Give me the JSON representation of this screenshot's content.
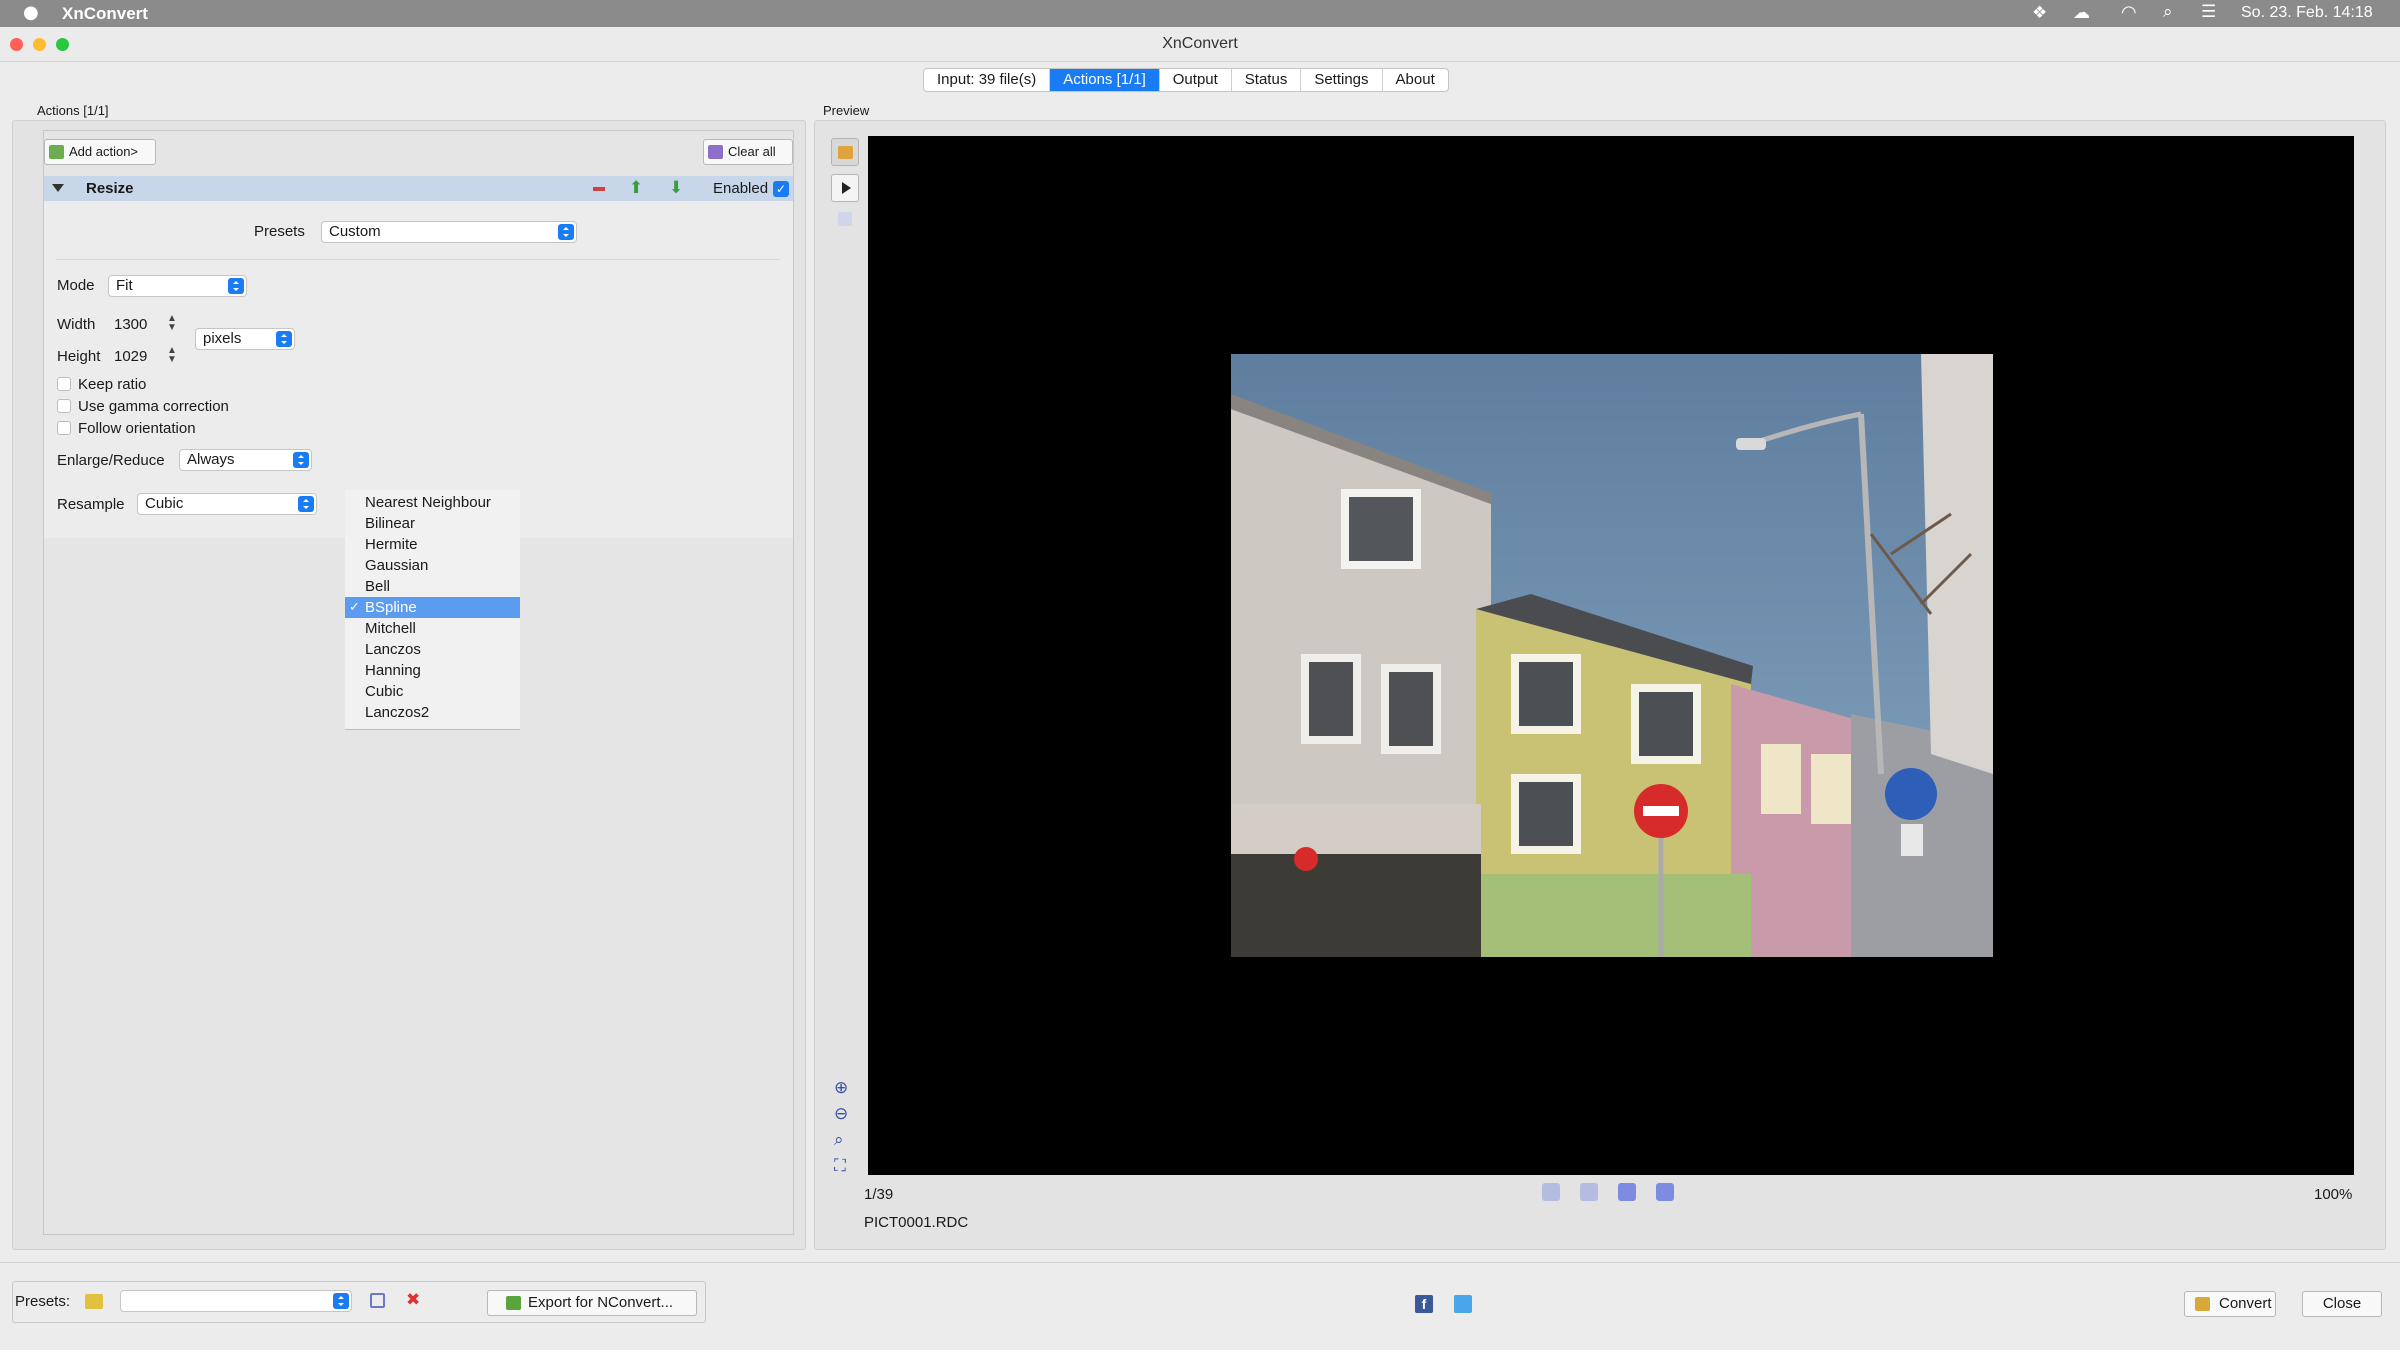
{
  "menubar": {
    "app_name": "XnConvert",
    "clock": "So. 23. Feb.  14:18",
    "icons": [
      "apple-icon",
      "dropbox-icon",
      "creative-cloud-icon",
      "wifi-icon",
      "spotlight-search-icon",
      "control-center-icon"
    ]
  },
  "window": {
    "title": "XnConvert",
    "traffic_lights": {
      "close": "#fe5f57",
      "minimize": "#febc2e",
      "zoom": "#28c840"
    }
  },
  "tabs": [
    {
      "label": "Input: 39 file(s)",
      "active": false
    },
    {
      "label": "Actions [1/1]",
      "active": true
    },
    {
      "label": "Output",
      "active": false
    },
    {
      "label": "Status",
      "active": false
    },
    {
      "label": "Settings",
      "active": false
    },
    {
      "label": "About",
      "active": false
    }
  ],
  "actions_panel": {
    "heading": "Actions [1/1]",
    "add_action_label": "Add action>",
    "clear_all_label": "Clear all",
    "action": {
      "name": "Resize",
      "enabled_label": "Enabled",
      "enabled": true,
      "presets_label": "Presets",
      "presets_value": "Custom",
      "mode_label": "Mode",
      "mode_value": "Fit",
      "width_label": "Width",
      "width_value": "1300",
      "height_label": "Height",
      "height_value": "1029",
      "unit_value": "pixels",
      "keep_ratio_label": "Keep ratio",
      "gamma_label": "Use gamma correction",
      "orientation_label": "Follow orientation",
      "enlarge_label": "Enlarge/Reduce",
      "enlarge_value": "Always",
      "resample_label": "Resample",
      "resample_value": "Cubic"
    },
    "resample_options": [
      "Nearest Neighbour",
      "Bilinear",
      "Hermite",
      "Gaussian",
      "Bell",
      "BSpline",
      "Mitchell",
      "Lanczos",
      "Hanning",
      "Cubic",
      "Lanczos2"
    ],
    "resample_highlighted": "BSpline"
  },
  "preview": {
    "heading": "Preview",
    "counter": "1/39",
    "zoom": "100%",
    "filename": "PICT0001.RDC"
  },
  "bottom": {
    "presets_label": "Presets:",
    "presets_value": "",
    "export_label": "Export for NConvert...",
    "convert_label": "Convert",
    "close_label": "Close"
  },
  "colors": {
    "accent": "#1a7cf5",
    "selection": "#5b9cf0",
    "panel_header": "#c8d6ea"
  }
}
